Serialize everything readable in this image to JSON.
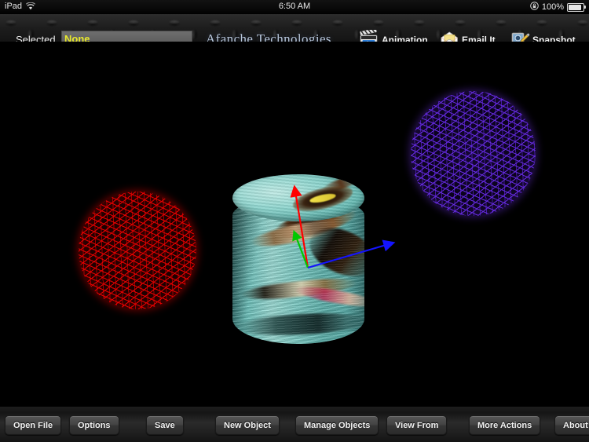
{
  "status_bar": {
    "device": "iPad",
    "wifi_icon": "wifi-icon",
    "time": "6:50 AM",
    "rotation_lock_icon": "rotation-lock-icon",
    "battery_percent": "100%",
    "battery_icon": "battery-icon"
  },
  "top_bar": {
    "selected_label": "Selected",
    "selected_value": "None",
    "brand": "Afanche Technologies",
    "actions": [
      {
        "label": "Animation",
        "icon": "clapperboard-icon"
      },
      {
        "label": "Email It",
        "icon": "envelope-icon"
      },
      {
        "label": "Snapshot",
        "icon": "camera-pencil-icon"
      }
    ]
  },
  "viewport": {
    "background_color": "#000000",
    "objects": [
      {
        "name": "red-wireframe-sphere",
        "type": "sphere",
        "color": "#e60000",
        "render": "wireframe"
      },
      {
        "name": "purple-wireframe-sphere",
        "type": "sphere",
        "color": "#642ade",
        "render": "wireframe"
      },
      {
        "name": "textured-cylinder",
        "type": "cylinder",
        "color": "#6fc6c0",
        "render": "textured"
      }
    ],
    "axes": [
      {
        "name": "z-axis",
        "color": "#ff0000"
      },
      {
        "name": "y-axis",
        "color": "#00c800"
      },
      {
        "name": "x-axis",
        "color": "#1414ff"
      }
    ]
  },
  "bottom_bar": {
    "buttons": [
      {
        "label": "Open File"
      },
      {
        "label": "Options"
      },
      {
        "label": "Save"
      },
      {
        "label": "New Object"
      },
      {
        "label": "Manage Objects"
      },
      {
        "label": "View From"
      },
      {
        "label": "More Actions"
      },
      {
        "label": "About"
      }
    ]
  }
}
